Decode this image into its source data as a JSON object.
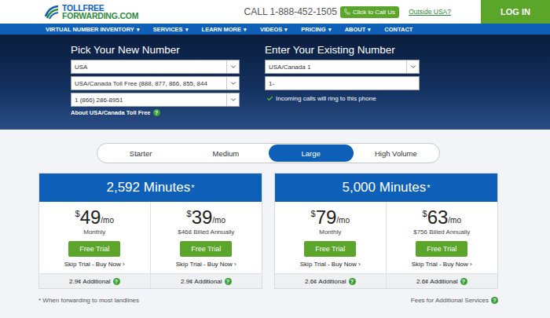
{
  "header": {
    "logo": {
      "top": "TOLLFREE",
      "bottom": "FORWARDING.COM"
    },
    "call": "CALL 1-888-452-1505",
    "click_to_call": "Click to Call Us",
    "outside": "Outside USA?",
    "login": "LOG IN"
  },
  "nav": {
    "caret": "▾",
    "items": [
      {
        "label": "VIRTUAL NUMBER INVENTORY",
        "has_menu": true
      },
      {
        "label": "SERVICES",
        "has_menu": true
      },
      {
        "label": "LEARN MORE",
        "has_menu": true
      },
      {
        "label": "VIDEOS",
        "has_menu": true
      },
      {
        "label": "PRICING",
        "has_menu": true
      },
      {
        "label": "ABOUT",
        "has_menu": true
      },
      {
        "label": "CONTACT",
        "has_menu": false
      }
    ]
  },
  "hero": {
    "pick": {
      "title": "Pick Your New Number",
      "fields": [
        "USA",
        "USA/Canada Toll Free (888, 877, 866, 855, 844",
        "1 (866) 286-8951"
      ],
      "about": "About USA/Canada Toll Free"
    },
    "existing": {
      "title": "Enter Your Existing Number",
      "fields": [
        {
          "value": "USA/Canada 1",
          "kind": "select"
        },
        {
          "value": "1-",
          "kind": "input"
        }
      ],
      "note": "Incoming calls will ring to this phone"
    }
  },
  "tabs": [
    {
      "label": "Starter",
      "selected": false
    },
    {
      "label": "Medium",
      "selected": false
    },
    {
      "label": "Large",
      "selected": true
    },
    {
      "label": "High Volume",
      "selected": false
    }
  ],
  "plans": [
    {
      "title": "2,592 Minutes",
      "mark": "*",
      "options": [
        {
          "currency": "$",
          "price": "49",
          "period": "/mo",
          "billing": "Monthly",
          "button": "Free Trial",
          "skip": "Skip Trial - Buy Now",
          "arrow": "›",
          "additional": "2.9¢ Additional"
        },
        {
          "currency": "$",
          "price": "39",
          "period": "/mo",
          "billing": "$468 Billed Annually",
          "button": "Free Trial",
          "skip": "Skip Trial - Buy Now",
          "arrow": "›",
          "additional": "2.9¢ Additional"
        }
      ]
    },
    {
      "title": "5,000 Minutes",
      "mark": "*",
      "options": [
        {
          "currency": "$",
          "price": "79",
          "period": "/mo",
          "billing": "Monthly",
          "button": "Free Trial",
          "skip": "Skip Trial - Buy Now",
          "arrow": "›",
          "additional": "2.6¢ Additional"
        },
        {
          "currency": "$",
          "price": "63",
          "period": "/mo",
          "billing": "$756 Billed Annually",
          "button": "Free Trial",
          "skip": "Skip Trial - Buy Now",
          "arrow": "›",
          "additional": "2.6¢ Additional"
        }
      ]
    }
  ],
  "help": "?",
  "footer": {
    "note": "* When forwarding to most landlines",
    "fees": "Fees for Additional Services"
  }
}
